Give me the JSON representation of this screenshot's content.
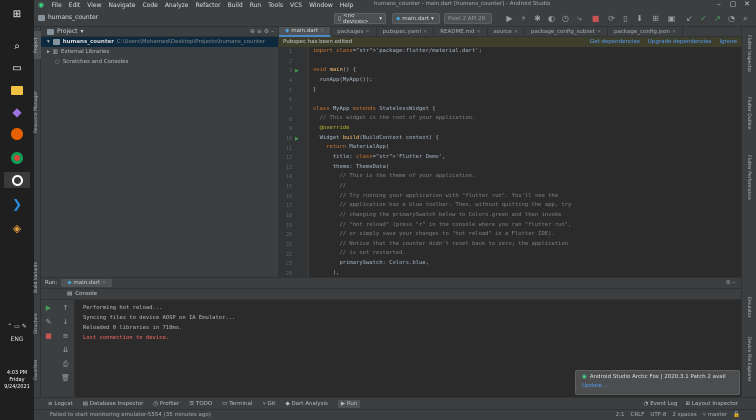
{
  "taskbar": {
    "icons": [
      "windows-start-icon",
      "search-icon",
      "task-view-icon",
      "file-explorer-icon",
      "visual-studio-icon",
      "firefox-icon",
      "chrome-icon",
      "android-studio-icon",
      "vscode-icon",
      "git-icon"
    ],
    "clock": {
      "time": "4:03 PM",
      "day": "Friday",
      "date": "9/24/2021"
    },
    "language": "ENG"
  },
  "window": {
    "title": "humans_counter - main.dart [humans_counter] - Android Studio",
    "menu": [
      "File",
      "Edit",
      "View",
      "Navigate",
      "Code",
      "Analyze",
      "Refactor",
      "Build",
      "Run",
      "Tools",
      "VCS",
      "Window",
      "Help"
    ]
  },
  "toolbar": {
    "project_name": "humans_counter",
    "device": "<no devices>",
    "run_config": "main.dart",
    "emulator": "Pixel 2 API 28"
  },
  "project_panel": {
    "header": "Project",
    "items": [
      {
        "label": "humans_counter",
        "path": "C:\\Users\\Mohamed\\Desktop\\Projects\\humans_counter"
      },
      {
        "label": "External Libraries",
        "path": ""
      },
      {
        "label": "Scratches and Consoles",
        "path": ""
      }
    ]
  },
  "left_strip": {
    "tabs": [
      "Project",
      "Resource Manager",
      "Build Variants",
      "Structure",
      "Favorites"
    ]
  },
  "right_strip": {
    "tabs": [
      "Flutter Inspector",
      "Flutter Outline",
      "Flutter Performance",
      "Emulator",
      "Device File Explorer"
    ]
  },
  "editor": {
    "tabs": [
      {
        "label": "main.dart",
        "active": true
      },
      {
        "label": "packages",
        "active": false
      },
      {
        "label": "pubspec.yaml",
        "active": false
      },
      {
        "label": "README.md",
        "active": false
      },
      {
        "label": "source",
        "active": false
      },
      {
        "label": "package_config_subset",
        "active": false
      },
      {
        "label": "package_config.json",
        "active": false
      }
    ],
    "banner": {
      "message": "Pubspec has been edited",
      "actions": [
        "Get dependencies",
        "Upgrade dependencies",
        "Ignore"
      ]
    },
    "line_numbers": [
      "1",
      "2",
      "3",
      "4",
      "5",
      "6",
      "7",
      "8",
      "9",
      "10",
      "11",
      "12",
      "13",
      "14",
      "15",
      "16",
      "17",
      "18",
      "19",
      "20",
      "21",
      "22",
      "23",
      "24"
    ],
    "code": [
      "import 'package:flutter/material.dart';",
      "",
      "void main() {",
      "  runApp(MyApp());",
      "}",
      "",
      "class MyApp extends StatelessWidget {",
      "  // This widget is the root of your application.",
      "  @override",
      "  Widget build(BuildContext context) {",
      "    return MaterialApp(",
      "      title: 'Flutter Demo',",
      "      theme: ThemeData(",
      "        // This is the theme of your application.",
      "        //",
      "        // Try running your application with \"flutter run\". You'll see the",
      "        // application has a blue toolbar. Then, without quitting the app, try",
      "        // changing the primarySwatch below to Colors.green and then invoke",
      "        // \"hot reload\" (press \"r\" in the console where you ran \"flutter run\",",
      "        // or simply save your changes to \"hot reload\" in a Flutter IDE).",
      "        // Notice that the counter didn't reset back to zero; the application",
      "        // is not restarted.",
      "        primarySwatch: Colors.blue,",
      "      ),"
    ]
  },
  "run_panel": {
    "header_label": "Run:",
    "config_tab": "main.dart",
    "console_tab": "Console",
    "lines": [
      {
        "text": "Performing hot reload...",
        "error": false
      },
      {
        "text": "Syncing files to device AOSP on IA Emulator...",
        "error": false
      },
      {
        "text": "Reloaded 0 libraries in 710ms.",
        "error": false
      },
      {
        "text": "Lost connection to device.",
        "error": true
      }
    ]
  },
  "notification": {
    "title": "Android Studio Arctic Fox | 2020.3.1 Patch 2 avail",
    "link": "Update..."
  },
  "bottom_tools": {
    "items": [
      "Logcat",
      "Database Inspector",
      "Profiler",
      "TODO",
      "Terminal",
      "Git",
      "Dart Analysis",
      "Run"
    ],
    "right": [
      "Event Log",
      "Layout Inspector"
    ]
  },
  "status": {
    "message": "Failed to start monitoring emulator-5554 (35 minutes ago)",
    "position": "2:1",
    "line_sep": "CRLF",
    "encoding": "UTF-8",
    "indent": "2 spaces",
    "branch": "master"
  },
  "colors": {
    "background": "#2b2b2b",
    "panel": "#3c3f41",
    "keyword": "#cc7832",
    "string": "#6a8759",
    "comment": "#808080",
    "function": "#ffc66d",
    "annotation": "#bbb529",
    "error": "#ff6b68",
    "link": "#589df6"
  }
}
